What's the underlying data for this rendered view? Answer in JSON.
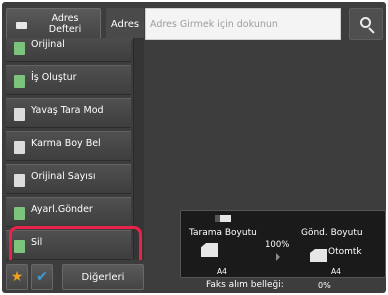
{
  "header": {
    "address_book_label": "Adres Defteri",
    "address_label": "Adres",
    "address_placeholder": "Adres Girmek için dokunun",
    "search_icon": "search-icon"
  },
  "modes": [
    {
      "label": "Orijinal",
      "icon": "original-icon"
    },
    {
      "label": "İş Oluştur",
      "icon": "job-build-icon"
    },
    {
      "label": "Yavaş Tara Mod",
      "icon": "slow-scan-icon"
    },
    {
      "label": "Karma Boy Bel",
      "icon": "mixed-size-icon"
    },
    {
      "label": "Orijinal Sayısı",
      "icon": "original-count-icon"
    },
    {
      "label": "Ayarl.Gönder",
      "icon": "timer-send-icon"
    },
    {
      "label": "Sil",
      "icon": "erase-icon"
    }
  ],
  "highlight_color": "#e8234a",
  "footer": {
    "favorites_icon": "star-icon",
    "check_icon": "checkmark-icon",
    "others_label": "Diğerleri"
  },
  "info": {
    "scan_size_label": "Tarama Boyutu",
    "send_size_label": "Gönd. Boyutu",
    "ratio": "100%",
    "send_auto": "Otomtk",
    "scan_size_value": "A4",
    "send_size_value": "A4",
    "fax_memory_label": "Faks alım belleği:",
    "fax_memory_value": "0%"
  }
}
